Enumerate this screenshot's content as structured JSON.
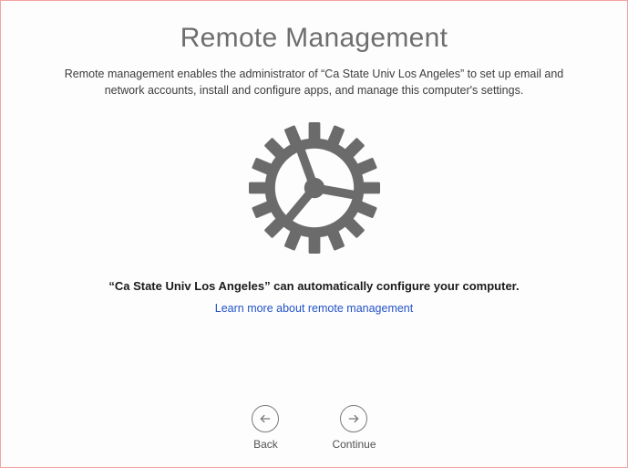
{
  "title": "Remote Management",
  "description": "Remote management enables the administrator of “Ca State Univ Los Angeles” to set up email and network accounts, install and configure apps, and manage this computer's settings.",
  "status_line": "“Ca State Univ Los Angeles” can automatically configure your computer.",
  "learn_more": "Learn more about remote management",
  "nav": {
    "back": "Back",
    "continue": "Continue"
  }
}
